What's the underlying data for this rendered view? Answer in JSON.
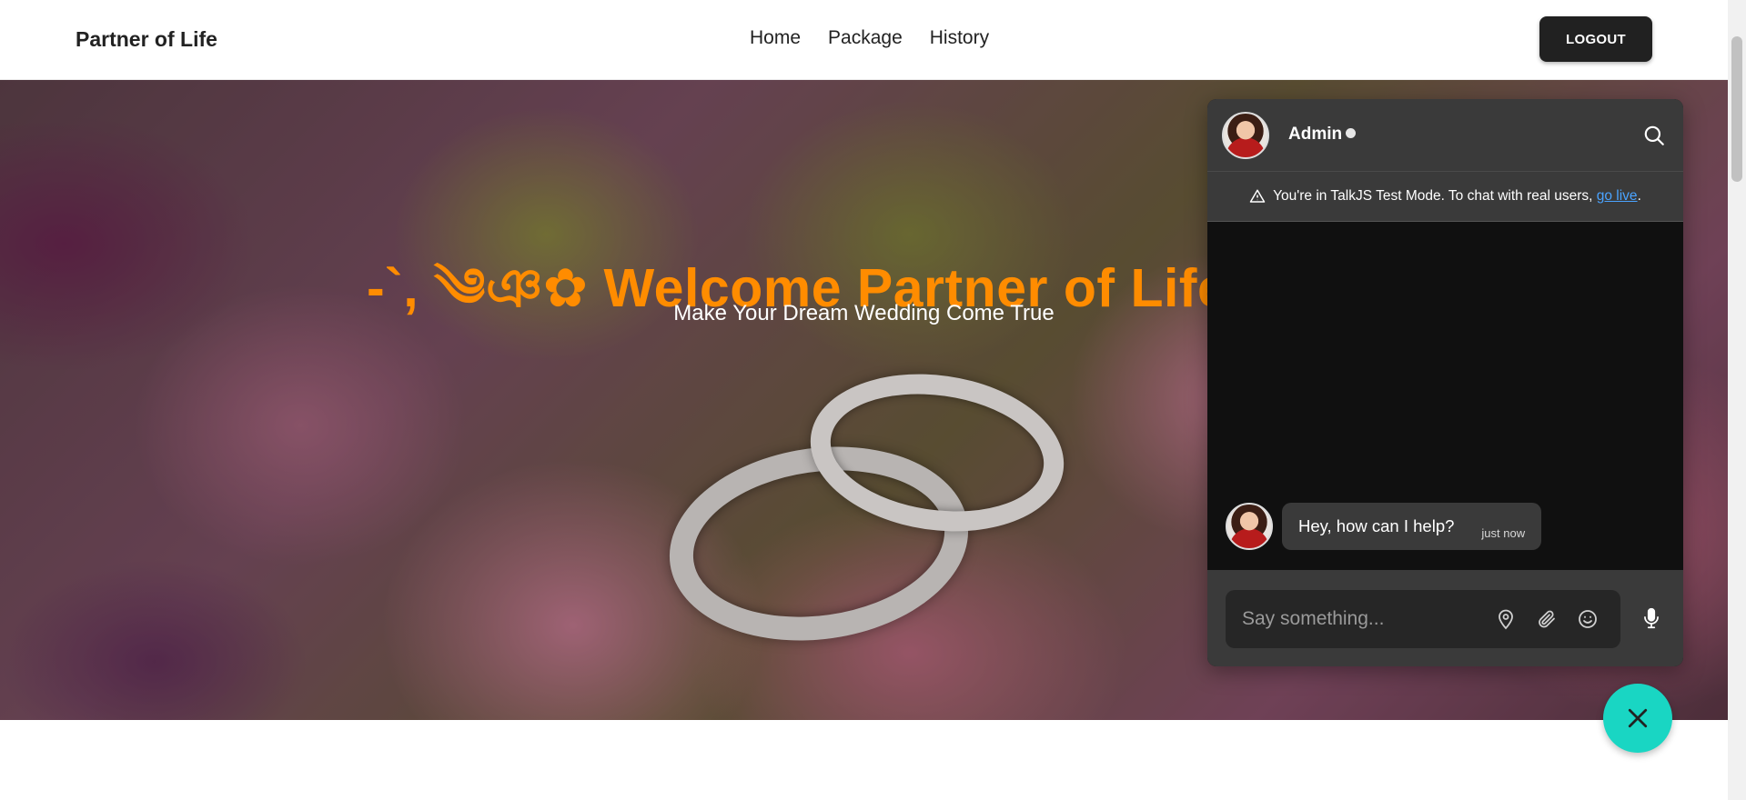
{
  "navbar": {
    "brand": "Partner of Life",
    "links": [
      {
        "label": "Home"
      },
      {
        "label": "Package"
      },
      {
        "label": "History"
      }
    ],
    "logout_label": "LOGOUT"
  },
  "hero": {
    "title": "-`, ༄ঞ✿ Welcome Partner of Life ✿",
    "subtitle": "Make Your Dream Wedding Come True"
  },
  "chat": {
    "header": {
      "name": "Admin",
      "status": "online"
    },
    "test_mode": {
      "text": "You're in TalkJS Test Mode. To chat with real users, ",
      "link": "go live",
      "suffix": "."
    },
    "messages": [
      {
        "text": "Hey, how can I help?",
        "time": "just now"
      }
    ],
    "composer": {
      "placeholder": "Say something..."
    },
    "colors": {
      "header_bg": "#3a3a3a",
      "body_bg": "#101010",
      "fab": "#19d6c3",
      "link": "#4aa3ff"
    }
  },
  "colors": {
    "title_accent": "#ff8c00",
    "logout_bg": "#212121"
  }
}
